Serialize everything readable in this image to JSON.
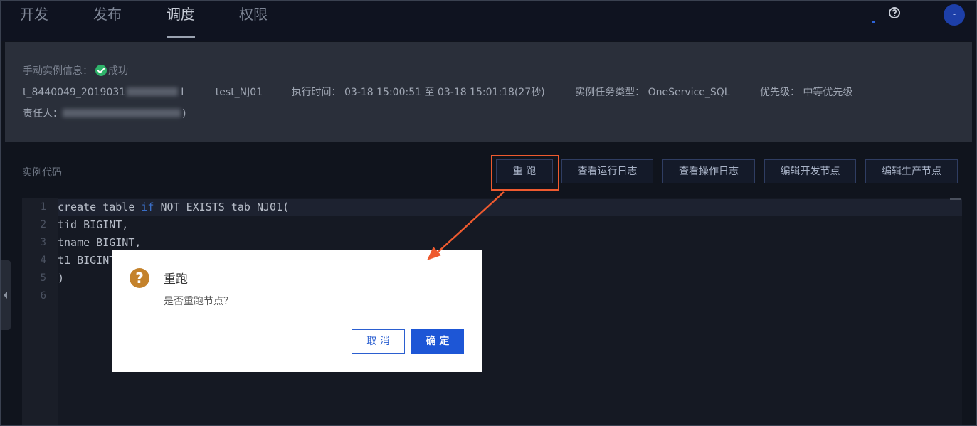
{
  "nav": {
    "tabs": [
      {
        "label": "开发"
      },
      {
        "label": "发布"
      },
      {
        "label": "调度"
      },
      {
        "label": "权限"
      }
    ],
    "active_tab": "调度",
    "avatar_text": "-"
  },
  "instance": {
    "heading_label": "手动实例信息：",
    "status": "成功",
    "id": "t_8440049_2019031",
    "name": "test_NJ01",
    "exec_time_label": "执行时间：",
    "exec_time": "03-18 15:00:51 至 03-18 15:01:18(27秒)",
    "task_type_label": "实例任务类型：",
    "task_type": "OneService_SQL",
    "priority_label": "优先级：",
    "priority": "中等优先级",
    "owner_label": "责任人：",
    "owner_suffix": ")"
  },
  "toolbar": {
    "section_label": "实例代码",
    "rerun": "重 跑",
    "view_run_log": "查看运行日志",
    "view_op_log": "查看操作日志",
    "edit_dev_node": "编辑开发节点",
    "edit_prod_node": "编辑生产节点"
  },
  "editor": {
    "line_numbers": [
      "1",
      "2",
      "3",
      "4",
      "5",
      "6"
    ],
    "lines": {
      "l1_pre": "create table ",
      "l1_kw": "if",
      "l1_post": " NOT EXISTS tab_NJ01(",
      "l2": "tid BIGINT,",
      "l3": "tname BIGINT,",
      "l4": "t1 BIGINT",
      "l5": ")"
    }
  },
  "dialog": {
    "title": "重跑",
    "message": "是否重跑节点？",
    "cancel": "取 消",
    "confirm": "确 定"
  },
  "colors": {
    "accent": "#1d56d6",
    "highlight": "#ee5a2f",
    "success": "#2fb36a",
    "warning_icon": "#c4822b"
  }
}
